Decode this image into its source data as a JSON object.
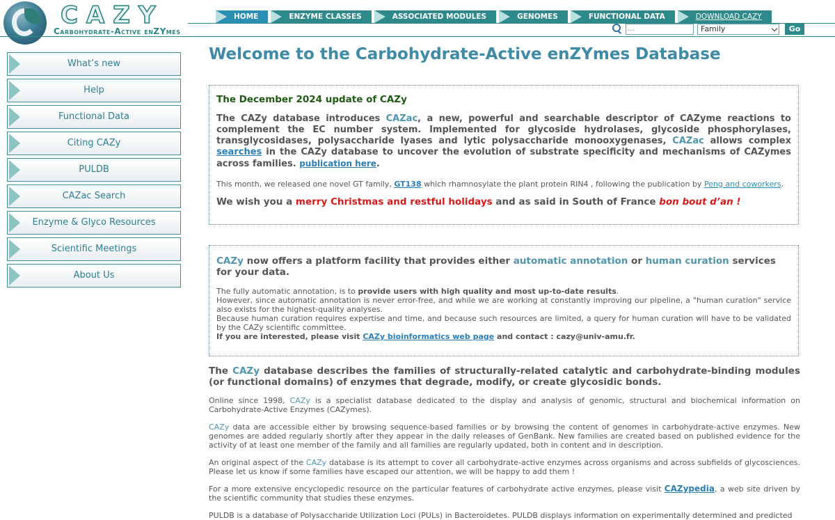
{
  "logo": {
    "word": "CAZY",
    "subtitle": "Carbohydrate-Active enZYmes"
  },
  "nav": {
    "items": [
      {
        "label": "HOME"
      },
      {
        "label": "ENZYME CLASSES"
      },
      {
        "label": "ASSOCIATED MODULES"
      },
      {
        "label": "GENOMES"
      },
      {
        "label": "FUNCTIONAL DATA"
      },
      {
        "label": "DOWNLOAD CAZY"
      }
    ]
  },
  "search": {
    "placeholder": "...",
    "select_value": "Family",
    "go_label": "Go"
  },
  "sidebar": {
    "items": [
      {
        "label": "What’s new"
      },
      {
        "label": "Help"
      },
      {
        "label": "Functional Data"
      },
      {
        "label": "Citing CAZy"
      },
      {
        "label": "PULDB"
      },
      {
        "label": "CAZac Search"
      },
      {
        "label": "Enzyme & Glyco Resources"
      },
      {
        "label": "Scientific Meetings"
      },
      {
        "label": "About Us"
      }
    ]
  },
  "main": {
    "title": "Welcome to the Carbohydrate-Active enZYmes Database",
    "update": {
      "title": "The December 2024 update of CAZy",
      "p1_a": "The CAZy database introduces ",
      "p1_cazac": "CAZac",
      "p1_b": ", a new, powerful and searchable descriptor of CAZyme reactions to complement the EC number system. Implemented for glycoside hydrolases, glycoside phosphorylases, transglycosidases, polysaccharide lyases and lytic polysaccharide monooxygenases, ",
      "p1_cazac2": "CAZac",
      "p1_c": " allows complex ",
      "p1_searches": "searches",
      "p1_d": " in the CAZy database to uncover the evolution of substrate specificity and mechanisms of CAZymes across families. ",
      "p1_pub": "publication here",
      "p1_e": ".",
      "month_a": "This month, we released one novel GT family, ",
      "month_gt": "GT138",
      "month_b": " which rhamnosylate the plant protein RIN4 , following the publication by ",
      "month_peng": "Peng and coworkers",
      "month_c": ".",
      "wish_a": "We wish you a ",
      "wish_red": "merry Christmas and restful holidays",
      "wish_b": " and as said in South of France ",
      "wish_it": "bon bout d’an !"
    },
    "platform": {
      "h_cazy": "CAZy",
      "h_a": " now offers a platform facility that provides either ",
      "h_auto": "automatic annotation",
      "h_or": " or ",
      "h_human": "human curation",
      "h_b": " services for your data.",
      "t1_a": "The fully automatic annotation, is to ",
      "t1_b": "provide users with high quality and most up-to-date results",
      "t1_c": ".",
      "t2": "However, since automatic annotation is never error-free, and while we are working at constantly improving our pipeline, a \"human curation\" service also exists for the highest-quality analyses.",
      "t3": "Because human curation requires expertise and time, and because such resources are limited, a query for human curation will have to be validated by the CAZy scientific committee.",
      "t4_a": "If you are interested, please visit ",
      "t4_link": "CAZy bioinformatics web page",
      "t4_b": " and contact : cazy@univ-amu.fr."
    },
    "intro": {
      "h_a": "The ",
      "h_cazy": "CAZy",
      "h_b": " database describes the families of structurally-related catalytic and carbohydrate-binding modules (or functional domains) of enzymes that degrade, modify, or create glycosidic bonds.",
      "p1_a": "Online since 1998, ",
      "p1_cazy": "CAZy",
      "p1_b": " is a specialist database dedicated to the display and analysis of genomic, structural and biochemical information on Carbohydrate-Active Enzymes (CAZymes).",
      "p2_cazy": "CAZy",
      "p2_b": " data are accessible either by browsing sequence-based families or by browsing the content of genomes in carbohydrate-active enzymes. New genomes are added regularly shortly after they appear in the daily releases of GenBank. New families are created based on published evidence for the activity of at least one member of the family and all families are regularly updated, both in content and in description.",
      "p3_a": "An original aspect of the ",
      "p3_cazy": "CAZy",
      "p3_b": " database is its attempt to cover all carbohydrate-active enzymes across organisms and across subfields of glycosciences. Please let us know if some families have escaped our attention, we will be happy to add them !",
      "p4_a": "For a more extensive encyclopedic resource on the particular features of carbohydrate active enzymes, please visit ",
      "p4_link": "CAZypedia",
      "p4_b": ", a web site driven by the scientific community that studies these enzymes.",
      "p5": "PULDB is a database of Polysaccharide Utilization Loci (PULs) in Bacteroidetes. PULDB displays information on experimentally determined and predicted"
    }
  },
  "colors": {
    "accent": "#2e8a8a",
    "title": "#3f8aa7",
    "link": "#2b7fb8",
    "red": "#d81a1a",
    "green": "#1e5a12"
  }
}
